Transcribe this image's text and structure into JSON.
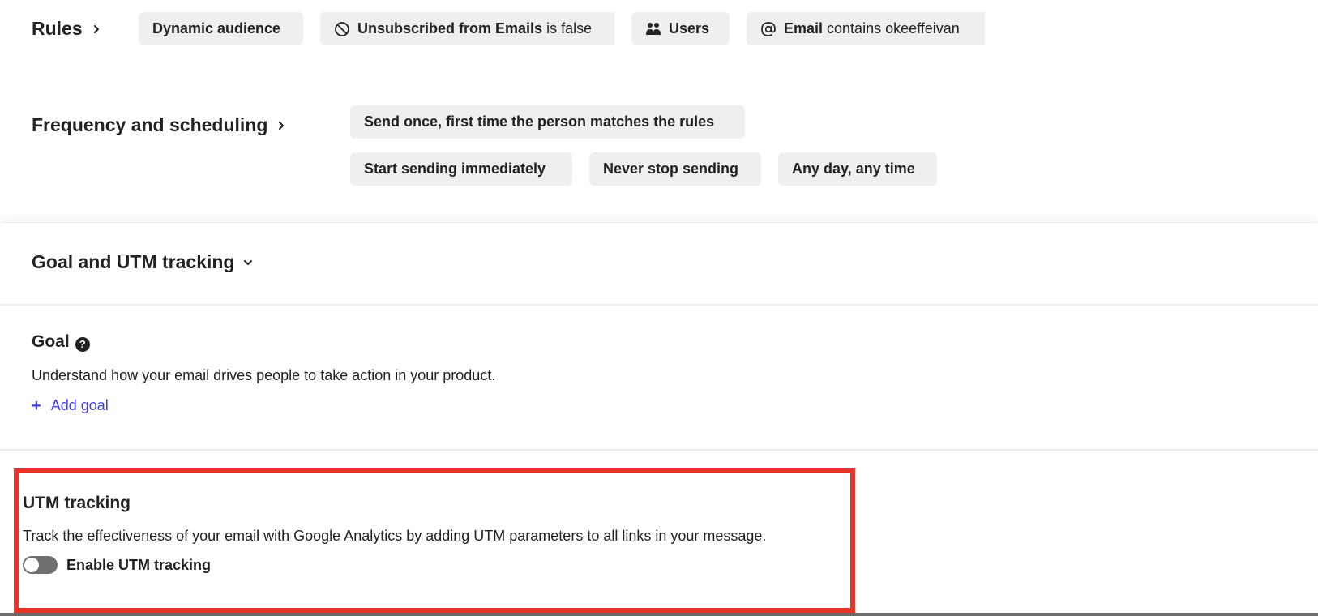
{
  "rules": {
    "heading": "Rules",
    "chips": [
      {
        "label": "Dynamic audience"
      },
      {
        "icon": "prohibited-icon",
        "bold": "Unsubscribed from Emails",
        "rest": " is false"
      },
      {
        "icon": "users-icon",
        "bold": "Users",
        "rest": ""
      },
      {
        "icon": "at-icon",
        "bold": "Email",
        "rest": " contains okeeffeivan"
      }
    ]
  },
  "frequency": {
    "heading": "Frequency and scheduling",
    "chips": [
      {
        "label": "Send once, first time the person matches the rules"
      },
      {
        "label": "Start sending immediately"
      },
      {
        "label": "Never stop sending"
      },
      {
        "label": "Any day, any time"
      }
    ]
  },
  "goal_utm": {
    "heading": "Goal and UTM tracking",
    "expanded": true
  },
  "goal": {
    "title": "Goal",
    "help_icon": "?",
    "description": "Understand how your email drives people to take action in your product.",
    "add_plus": "+",
    "add_label": "Add goal",
    "link_color": "#3d3bf0"
  },
  "utm": {
    "title": "UTM tracking",
    "description": "Track the effectiveness of your email with Google Analytics by adding UTM parameters to all links in your message.",
    "toggle_label": "Enable UTM tracking",
    "enabled": false,
    "highlight_color": "#e8332b"
  }
}
